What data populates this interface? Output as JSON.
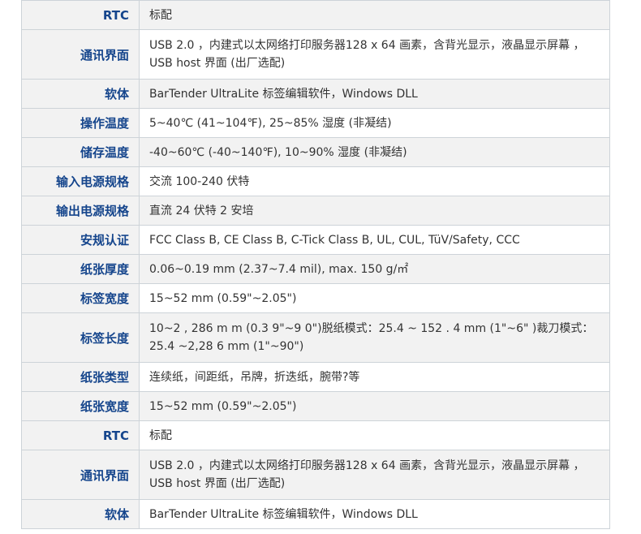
{
  "rows": [
    {
      "label": "RTC",
      "value": "标配"
    },
    {
      "label": "通讯界面",
      "value": "USB 2.0 ，内建式以太网络打印服务器128 x 64 画素，含背光显示，液晶显示屏幕 ，USB host 界面 (出厂选配)"
    },
    {
      "label": "软体",
      "value": "BarTender UltraLite 标签编辑软件，Windows DLL"
    },
    {
      "label": "操作温度",
      "value": "5~40℃ (41~104℉), 25~85% 湿度 (非凝结)"
    },
    {
      "label": "储存温度",
      "value": " -40~60℃ (-40~140℉), 10~90% 湿度 (非凝结)"
    },
    {
      "label": "输入电源规格",
      "value": "交流 100-240 伏特"
    },
    {
      "label": "输出电源规格",
      "value": "直流 24 伏特 2 安培"
    },
    {
      "label": "安规认证",
      "value": "FCC Class B, CE Class B, C-Tick Class B, UL, CUL, TüV/Safety, CCC"
    },
    {
      "label": "纸张厚度",
      "value": "0.06~0.19 mm (2.37~7.4 mil), max. 150 g/㎡"
    },
    {
      "label": "标签宽度",
      "value": "15~52 mm (0.59\"~2.05\")"
    },
    {
      "label": "标签长度",
      "value": "10~2 , 286 m m (0.3 9\"~9 0\")脱纸模式：25.4 ~ 152 . 4 mm (1\"~6\" )裁刀模式：25.4 ~2,28 6 mm (1\"~90\")"
    },
    {
      "label": "纸张类型",
      "value": "连续纸，间距纸，吊牌，折迭纸，腕带?等"
    },
    {
      "label": "纸张宽度",
      "value": "15~52 mm (0.59\"~2.05\")"
    },
    {
      "label": "RTC",
      "value": "标配"
    },
    {
      "label": "通讯界面",
      "value": "USB 2.0 ，内建式以太网络打印服务器128 x 64 画素，含背光显示，液晶显示屏幕 ，USB host 界面 (出厂选配)"
    },
    {
      "label": "软体",
      "value": "BarTender UltraLite 标签编辑软件，Windows DLL"
    }
  ]
}
